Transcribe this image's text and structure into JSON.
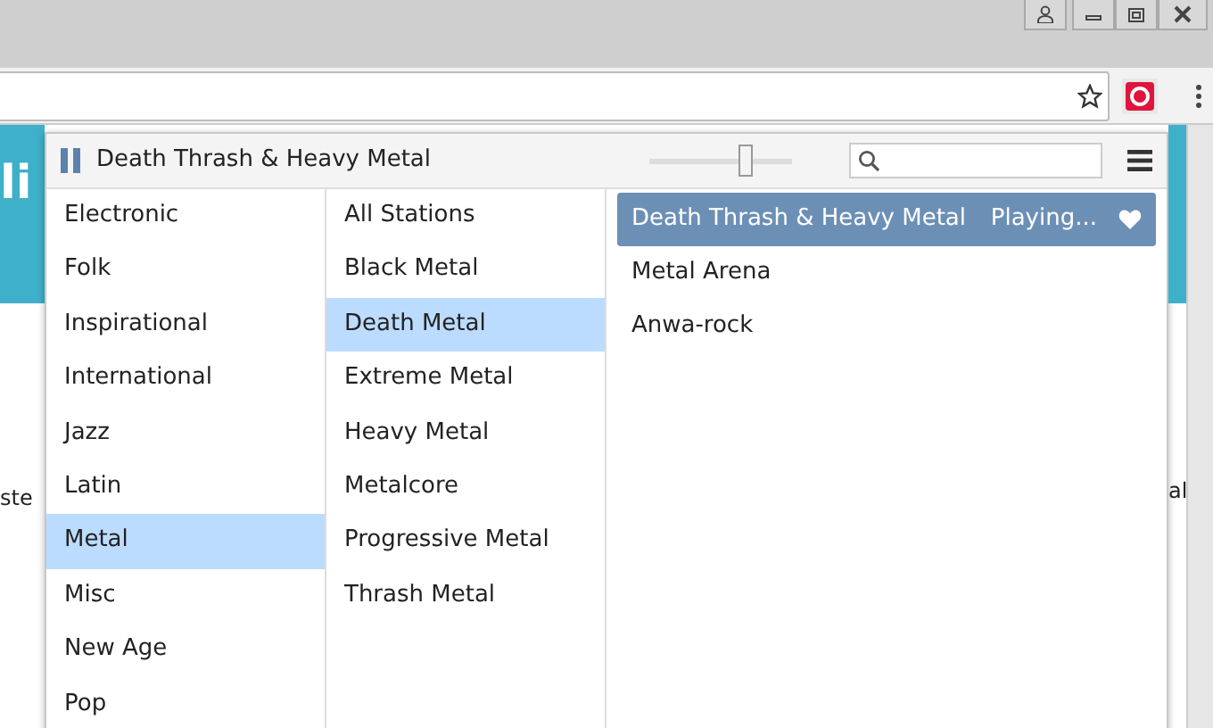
{
  "browser": {
    "address_bar": {
      "bookmarked": false
    }
  },
  "background_page": {
    "heading": "li",
    "left_text": "ste",
    "right_text": "al"
  },
  "player": {
    "now_playing": "Death Thrash & Heavy Metal",
    "paused": false,
    "volume": {
      "level": 0.68
    }
  },
  "genres": [
    {
      "label": "Electronic",
      "selected": false
    },
    {
      "label": "Folk",
      "selected": false
    },
    {
      "label": "Inspirational",
      "selected": false
    },
    {
      "label": "International",
      "selected": false
    },
    {
      "label": "Jazz",
      "selected": false
    },
    {
      "label": "Latin",
      "selected": false
    },
    {
      "label": "Metal",
      "selected": true
    },
    {
      "label": "Misc",
      "selected": false
    },
    {
      "label": "New Age",
      "selected": false
    },
    {
      "label": "Pop",
      "selected": false
    }
  ],
  "subgenres": [
    {
      "label": "All Stations",
      "selected": false
    },
    {
      "label": "Black Metal",
      "selected": false
    },
    {
      "label": "Death Metal",
      "selected": true
    },
    {
      "label": "Extreme Metal",
      "selected": false
    },
    {
      "label": "Heavy Metal",
      "selected": false
    },
    {
      "label": "Metalcore",
      "selected": false
    },
    {
      "label": "Progressive Metal",
      "selected": false
    },
    {
      "label": "Thrash Metal",
      "selected": false
    }
  ],
  "stations": [
    {
      "name": "Death Thrash & Heavy Metal",
      "status": "Playing...",
      "favorite": true,
      "selected": true
    },
    {
      "name": "Metal Arena",
      "favorite": false,
      "selected": false
    },
    {
      "name": "Anwa-rock",
      "favorite": false,
      "selected": false
    }
  ]
}
